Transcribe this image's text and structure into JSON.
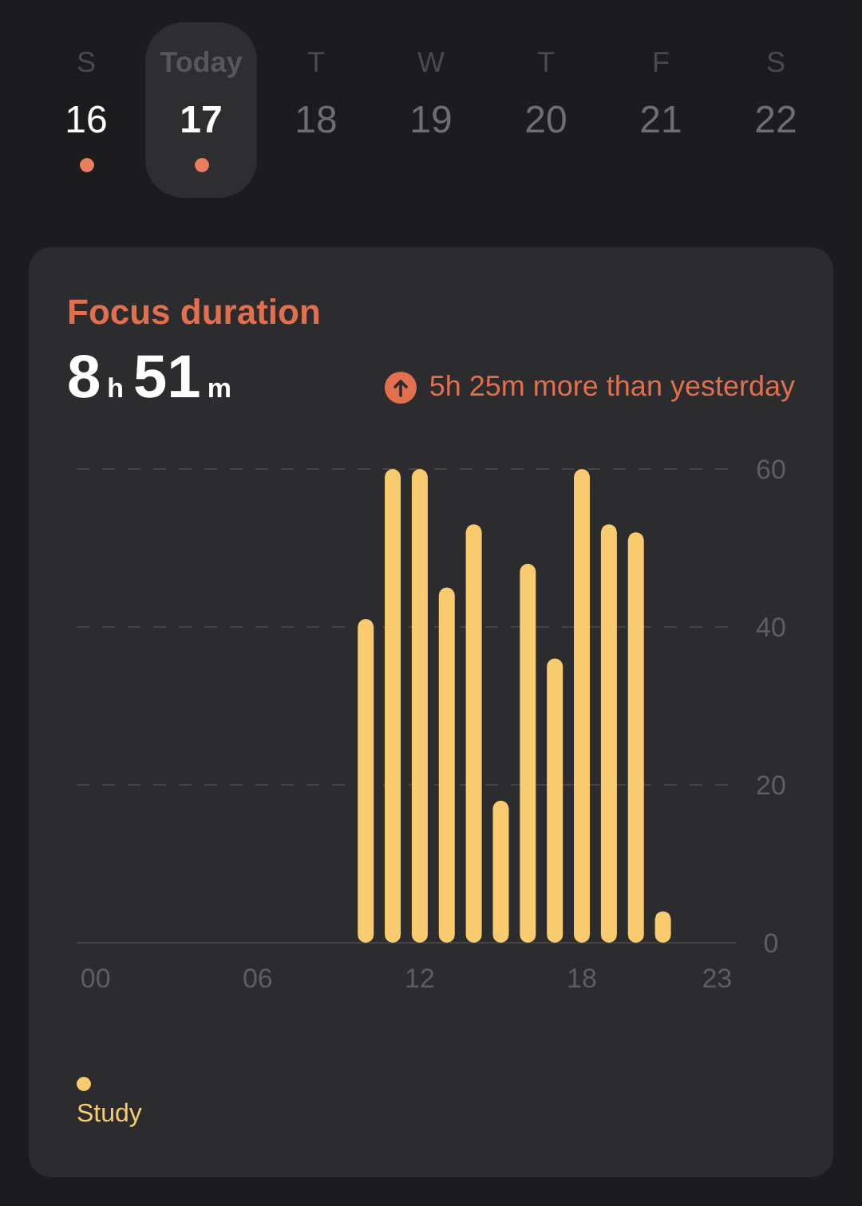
{
  "week": [
    {
      "weekday": "S",
      "date": "16",
      "has_record": true,
      "selected": false
    },
    {
      "weekday": "Today",
      "date": "17",
      "has_record": true,
      "selected": true
    },
    {
      "weekday": "T",
      "date": "18",
      "has_record": false,
      "selected": false
    },
    {
      "weekday": "W",
      "date": "19",
      "has_record": false,
      "selected": false
    },
    {
      "weekday": "T",
      "date": "20",
      "has_record": false,
      "selected": false
    },
    {
      "weekday": "F",
      "date": "21",
      "has_record": false,
      "selected": false
    },
    {
      "weekday": "S",
      "date": "22",
      "has_record": false,
      "selected": false
    }
  ],
  "card": {
    "title": "Focus duration",
    "hours": "8",
    "hours_unit": "h",
    "minutes": "51",
    "minutes_unit": "m",
    "comparison": "5h 25m more than yesterday",
    "chart_data": {
      "type": "bar",
      "x": [
        10,
        11,
        12,
        13,
        14,
        15,
        16,
        17,
        18,
        19,
        20,
        21
      ],
      "series": [
        {
          "name": "Study",
          "color": "#f8cb6e",
          "values": [
            41,
            60,
            60,
            45,
            53,
            18,
            48,
            36,
            60,
            53,
            52,
            4
          ]
        }
      ],
      "xlim": [
        -0.7,
        23.7
      ],
      "ylim": [
        0,
        60
      ],
      "xticks": [
        {
          "value": 0,
          "label": "00"
        },
        {
          "value": 6,
          "label": "06"
        },
        {
          "value": 12,
          "label": "12"
        },
        {
          "value": 18,
          "label": "18"
        },
        {
          "value": 23,
          "label": "23"
        }
      ],
      "yticks": [
        0,
        20,
        40,
        60
      ]
    }
  }
}
